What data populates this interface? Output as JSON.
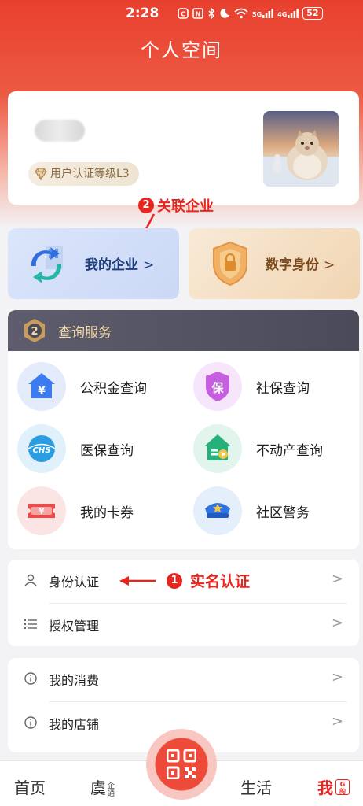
{
  "status_bar": {
    "time": "2:28",
    "icons": [
      "nfc-icon",
      "n-icon",
      "bluetooth-icon",
      "moon-icon",
      "wifi-icon",
      "5g-signal-icon",
      "4g-signal-icon"
    ],
    "signal_5g": "5G",
    "signal_4g": "4G",
    "battery": "52"
  },
  "header": {
    "title": "个人空间"
  },
  "profile": {
    "level_badge": "用户认证等级L3"
  },
  "annotations": {
    "two_number": "2",
    "two_text": "关联企业",
    "one_number": "1",
    "one_text": "实名认证"
  },
  "quick_cards": {
    "enterprise": {
      "label": "我的企业",
      "chevron": ">"
    },
    "digital_id": {
      "label": "数字身份",
      "chevron": ">"
    }
  },
  "query_services": {
    "title": "查询服务",
    "items": [
      {
        "label": "公积金查询",
        "icon": "housing-fund-icon"
      },
      {
        "label": "社保查询",
        "icon": "social-security-icon"
      },
      {
        "label": "医保查询",
        "icon": "medical-insurance-icon"
      },
      {
        "label": "不动产查询",
        "icon": "real-estate-icon"
      },
      {
        "label": "我的卡券",
        "icon": "coupon-icon"
      },
      {
        "label": "社区警务",
        "icon": "police-icon"
      }
    ]
  },
  "menu1": [
    {
      "label": "身份认证",
      "icon": "user-icon"
    },
    {
      "label": "授权管理",
      "icon": "list-icon"
    }
  ],
  "menu2": [
    {
      "label": "我的消费",
      "icon": "info-icon"
    },
    {
      "label": "我的店铺",
      "icon": "info-icon"
    }
  ],
  "chevron": ">",
  "tabbar": {
    "home": "首页",
    "yu": "虞",
    "yu_small_1": "企",
    "yu_small_2": "通",
    "life": "生活",
    "me": "我",
    "me_badge_1": "G",
    "me_badge_2": "的"
  },
  "colors": {
    "brand_red": "#e8251e",
    "header_red": "#e8402e"
  }
}
